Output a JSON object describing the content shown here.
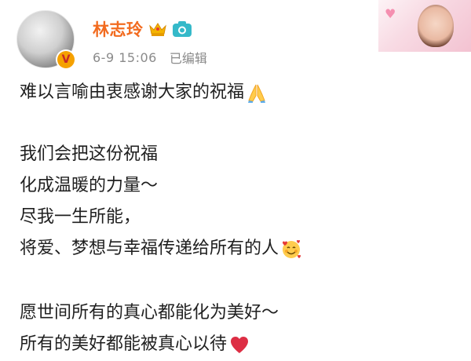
{
  "header": {
    "username": "林志玲",
    "timestamp": "6-9 15:06",
    "edited_label": "已编辑",
    "icons": {
      "verified": "verified-v-badge-icon",
      "crown": "crown-icon",
      "camera": "camera-icon"
    },
    "verified_letter": "V",
    "accent_color": "#f26b1f",
    "meta_color": "#8a8a8a"
  },
  "post": {
    "lines": [
      "难以言喻由衷感谢大家的祝福",
      "我们会把这份祝福",
      "化成温暖的力量～",
      "尽我一生所能，",
      "将爱、梦想与幸福传递给所有的人",
      "愿世间所有的真心都能化为美好～",
      "所有的美好都能被真心以待"
    ],
    "emojis": {
      "line0": "folded-hands-emoji",
      "line4": "smiling-face-with-hearts-emoji",
      "line6": "red-heart-emoji"
    },
    "text_color": "#1f1f1f"
  }
}
